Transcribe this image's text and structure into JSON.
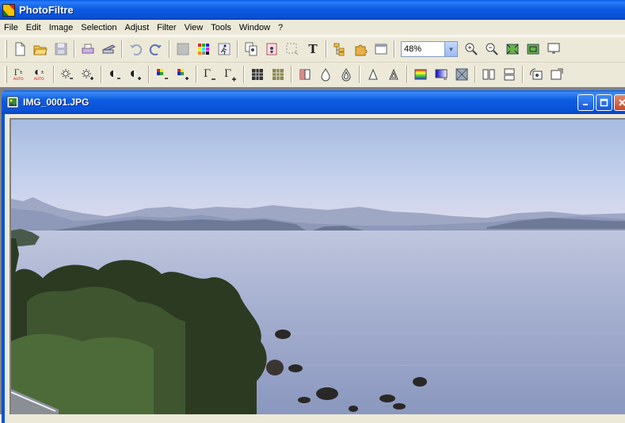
{
  "app": {
    "title": "PhotoFiltre"
  },
  "menu": [
    "File",
    "Edit",
    "Image",
    "Selection",
    "Adjust",
    "Filter",
    "View",
    "Tools",
    "Window",
    "?"
  ],
  "toolbar": {
    "zoom_value": "48%"
  },
  "document": {
    "title": "IMG_0001.JPG"
  },
  "colors": {
    "titlebar": "#0A52D6",
    "face": "#ECE9D8",
    "sky": "#C9D6EE",
    "water": "#9AA6C6"
  }
}
